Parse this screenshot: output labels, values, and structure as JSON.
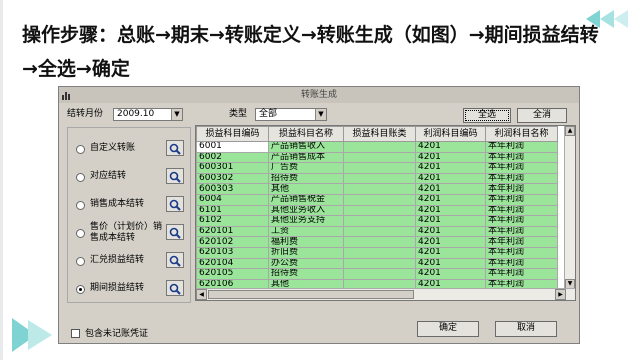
{
  "heading": "操作步骤：总账→期末→转账定义→转账生成（如图）→期间损益结转→全选→确定",
  "dialog": {
    "title": "转账生成",
    "period_label": "结转月份",
    "period_value": "2009.10",
    "type_label": "类型",
    "type_value": "全部",
    "select_all_button": "全选",
    "clear_all_button": "全消",
    "options": [
      {
        "label": "自定义转账",
        "selected": false
      },
      {
        "label": "对应结转",
        "selected": false
      },
      {
        "label": "销售成本结转",
        "selected": false
      },
      {
        "label": "售价（计划价）销售成本结转",
        "selected": false
      },
      {
        "label": "汇兑损益结转",
        "selected": false
      },
      {
        "label": "期间损益结转",
        "selected": true
      }
    ],
    "table": {
      "columns": [
        "损益科目编码",
        "损益科目名称",
        "损益科目账类",
        "利润科目编码",
        "利润科目名称"
      ],
      "rows": [
        [
          "6001",
          "产品销售收入",
          "",
          "4201",
          "本年利润"
        ],
        [
          "6002",
          "产品销售成本",
          "",
          "4201",
          "本年利润"
        ],
        [
          "600301",
          "广告费",
          "",
          "4201",
          "本年利润"
        ],
        [
          "600302",
          "招待费",
          "",
          "4201",
          "本年利润"
        ],
        [
          "600303",
          "其他",
          "",
          "4201",
          "本年利润"
        ],
        [
          "6004",
          "产品销售税金",
          "",
          "4201",
          "本年利润"
        ],
        [
          "6101",
          "其他业务收入",
          "",
          "4201",
          "本年利润"
        ],
        [
          "6102",
          "其他业务支持",
          "",
          "4201",
          "本年利润"
        ],
        [
          "620101",
          "工资",
          "",
          "4201",
          "本年利润"
        ],
        [
          "620102",
          "福利费",
          "",
          "4201",
          "本年利润"
        ],
        [
          "620103",
          "折旧费",
          "",
          "4201",
          "本年利润"
        ],
        [
          "620104",
          "办公费",
          "",
          "4201",
          "本年利润"
        ],
        [
          "620105",
          "招待费",
          "",
          "4201",
          "本年利润"
        ],
        [
          "620106",
          "其他",
          "",
          "4201",
          "本年利润"
        ]
      ]
    },
    "include_unposted_label": "包含未记账凭证",
    "ok_button": "确定",
    "cancel_button": "取消"
  },
  "colors": {
    "row_highlight": "#9be59b",
    "decoration": "#7fd3d3"
  }
}
